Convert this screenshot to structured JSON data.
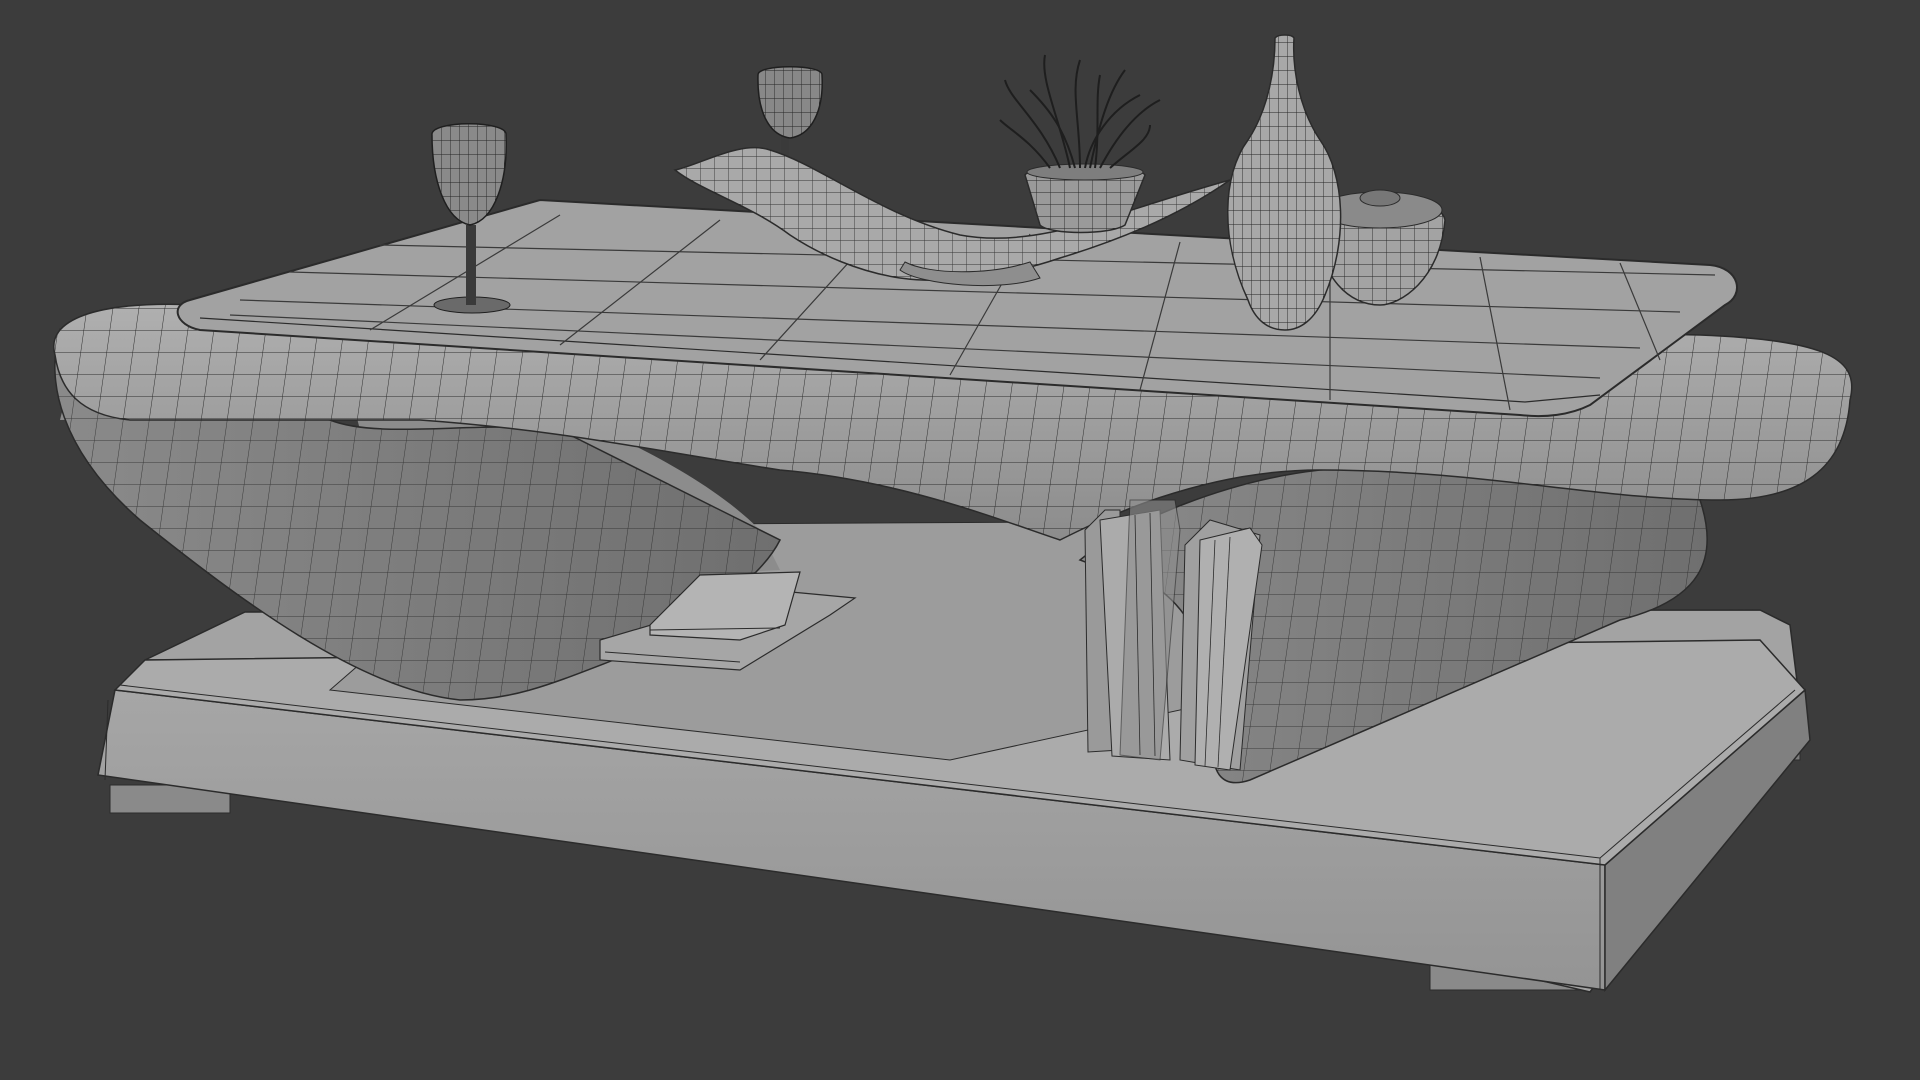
{
  "viewport": {
    "background": "#3c3c3c",
    "shading": "wireframe-over-solid",
    "subject": "coffee-table-with-decor"
  },
  "colors": {
    "surface_light": "#a9a9a9",
    "surface_mid": "#979797",
    "surface_dark": "#7d7d7d",
    "wire": "#2b2b2b",
    "glass": "#8e8e8e"
  },
  "objects": [
    "base-plinth",
    "organic-table-body",
    "tabletop-panel",
    "wine-glass-left",
    "wine-glass-back",
    "decorative-tray",
    "plant-pot",
    "vase-tall",
    "bowl-small",
    "books-lying",
    "books-standing"
  ]
}
